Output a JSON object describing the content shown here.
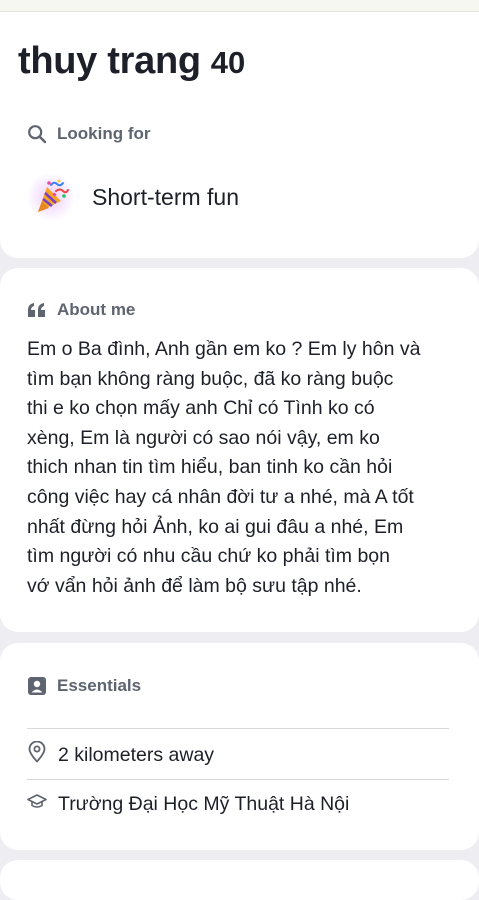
{
  "profile": {
    "name": "thuy trang",
    "age": "40"
  },
  "looking_for": {
    "heading": "Looking for",
    "heading_icon": "search-icon",
    "value": "Short-term fun",
    "value_icon": "party-popper-icon"
  },
  "about": {
    "heading": "About me",
    "heading_icon": "quote-icon",
    "lines": [
      "Em o Ba đình, Anh gần em ko ? Em ly hôn và",
      "tìm bạn không ràng buộc, đã ko ràng buộc",
      "thi e ko chọn mấy anh Chỉ có Tình ko có",
      "xèng, Em là người có sao nói vậy, em ko",
      "thich nhan tin tìm hiểu, ban tinh ko cần hỏi",
      "công việc hay cá nhân đời tư a nhé, mà A tốt",
      "nhất đừng hỏi Ảnh, ko ai gui đâu a nhé, Em",
      "tìm người có nhu cầu chứ ko phải tìm bọn",
      "vớ vẩn hỏi ảnh để làm bộ sưu tập nhé."
    ]
  },
  "essentials": {
    "heading": "Essentials",
    "heading_icon": "id-badge-icon",
    "items": [
      {
        "icon": "location-pin-icon",
        "label": "2 kilometers away"
      },
      {
        "icon": "graduation-cap-icon",
        "label": "Trường Đại Học Mỹ Thuật Hà Nội"
      }
    ]
  },
  "colors": {
    "text": "#1d2028",
    "muted": "#5e6470",
    "background": "#eeeef2",
    "card": "#ffffff"
  }
}
